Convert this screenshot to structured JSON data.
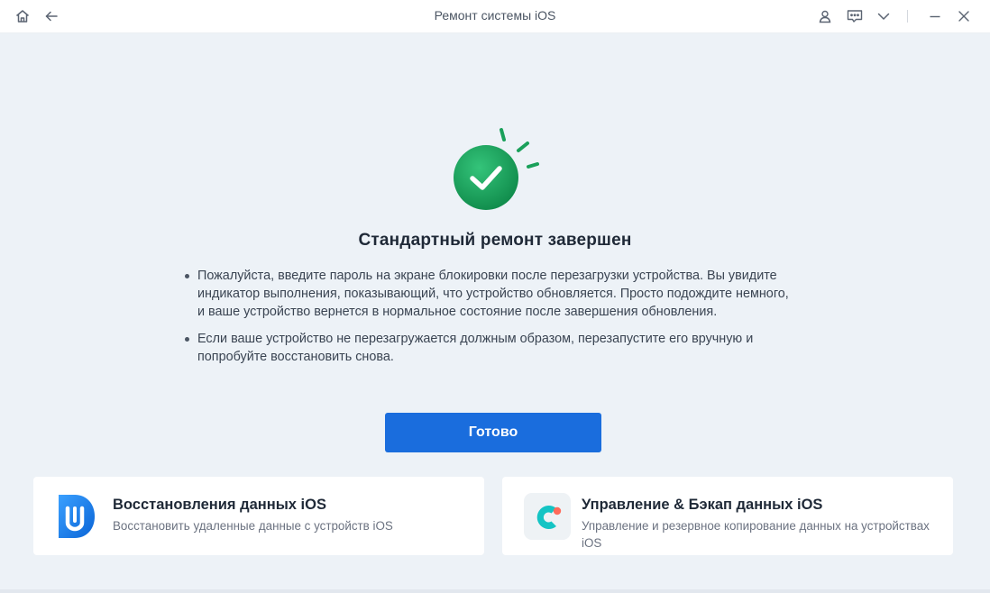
{
  "window": {
    "title": "Ремонт системы iOS",
    "icons": [
      "home-icon",
      "back-arrow-icon",
      "user-icon",
      "feedback-icon",
      "chevron-down-icon",
      "minimize-icon",
      "close-icon"
    ]
  },
  "status": {
    "heading": "Стандартный ремонт завершен",
    "bullets": [
      "Пожалуйста, введите пароль на экране блокировки после перезагрузки устройства. Вы увидите индикатор выполнения, показывающий, что устройство обновляется. Просто подождите немного, и ваше устройство вернется в нормальное состояние после завершения обновления.",
      "Если ваше устройство не перезагружается должным образом, перезапустите его вручную и попробуйте восстановить снова."
    ],
    "done_label": "Готово"
  },
  "cards": [
    {
      "title": "Восстановления данных iOS",
      "subtitle": "Восстановить удаленные данные с устройств iOS",
      "icon": "data-recovery-app-icon"
    },
    {
      "title": "Управление & Бэкап данных iOS",
      "subtitle": "Управление и резервное копирование данных на устройствах iOS",
      "icon": "backup-manager-app-icon"
    }
  ],
  "colors": {
    "accent": "#1a6ddd",
    "success": "#1aa05a",
    "background": "#edf2f7"
  }
}
